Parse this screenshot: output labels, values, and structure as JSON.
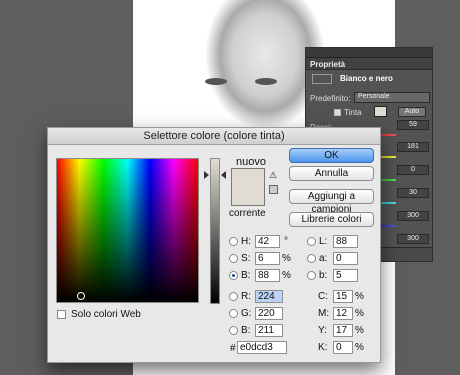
{
  "properties_panel": {
    "tab_label": "Proprietà",
    "adjustment_title": "Bianco e nero",
    "preset_label": "Predefinito:",
    "preset_value": "Personale",
    "tint_label": "Tinta",
    "auto_label": "Auto",
    "first_row_label": "Rossi:",
    "values": [
      "59",
      "181",
      "0",
      "30",
      "300",
      "300"
    ]
  },
  "dialog": {
    "title": "Selettore colore (colore tinta)",
    "new_label": "nuovo",
    "current_label": "corrente",
    "current_color": "#e0dcd3",
    "buttons": {
      "ok": "OK",
      "cancel": "Annulla",
      "add_to_swatches": "Aggiungi a campioni",
      "color_libraries": "Librerie colori"
    },
    "web_only_label": "Solo colori Web",
    "hsb": {
      "h_label": "H:",
      "h_value": "42",
      "h_unit": "°",
      "s_label": "S:",
      "s_value": "6",
      "s_unit": "%",
      "b_label": "B:",
      "b_value": "88",
      "b_unit": "%"
    },
    "rgb": {
      "r_label": "R:",
      "r_value": "224",
      "g_label": "G:",
      "g_value": "220",
      "b_label": "B:",
      "b_value": "211"
    },
    "lab": {
      "l_label": "L:",
      "l_value": "88",
      "a_label": "a:",
      "a_value": "0",
      "b_label": "b:",
      "b_value": "5"
    },
    "cmyk": {
      "c_label": "C:",
      "c_value": "15",
      "c_unit": "%",
      "m_label": "M:",
      "m_value": "12",
      "m_unit": "%",
      "y_label": "Y:",
      "y_value": "17",
      "y_unit": "%",
      "k_label": "K:",
      "k_value": "0",
      "k_unit": "%"
    },
    "hex_label": "#",
    "hex_value": "e0dcd3"
  }
}
